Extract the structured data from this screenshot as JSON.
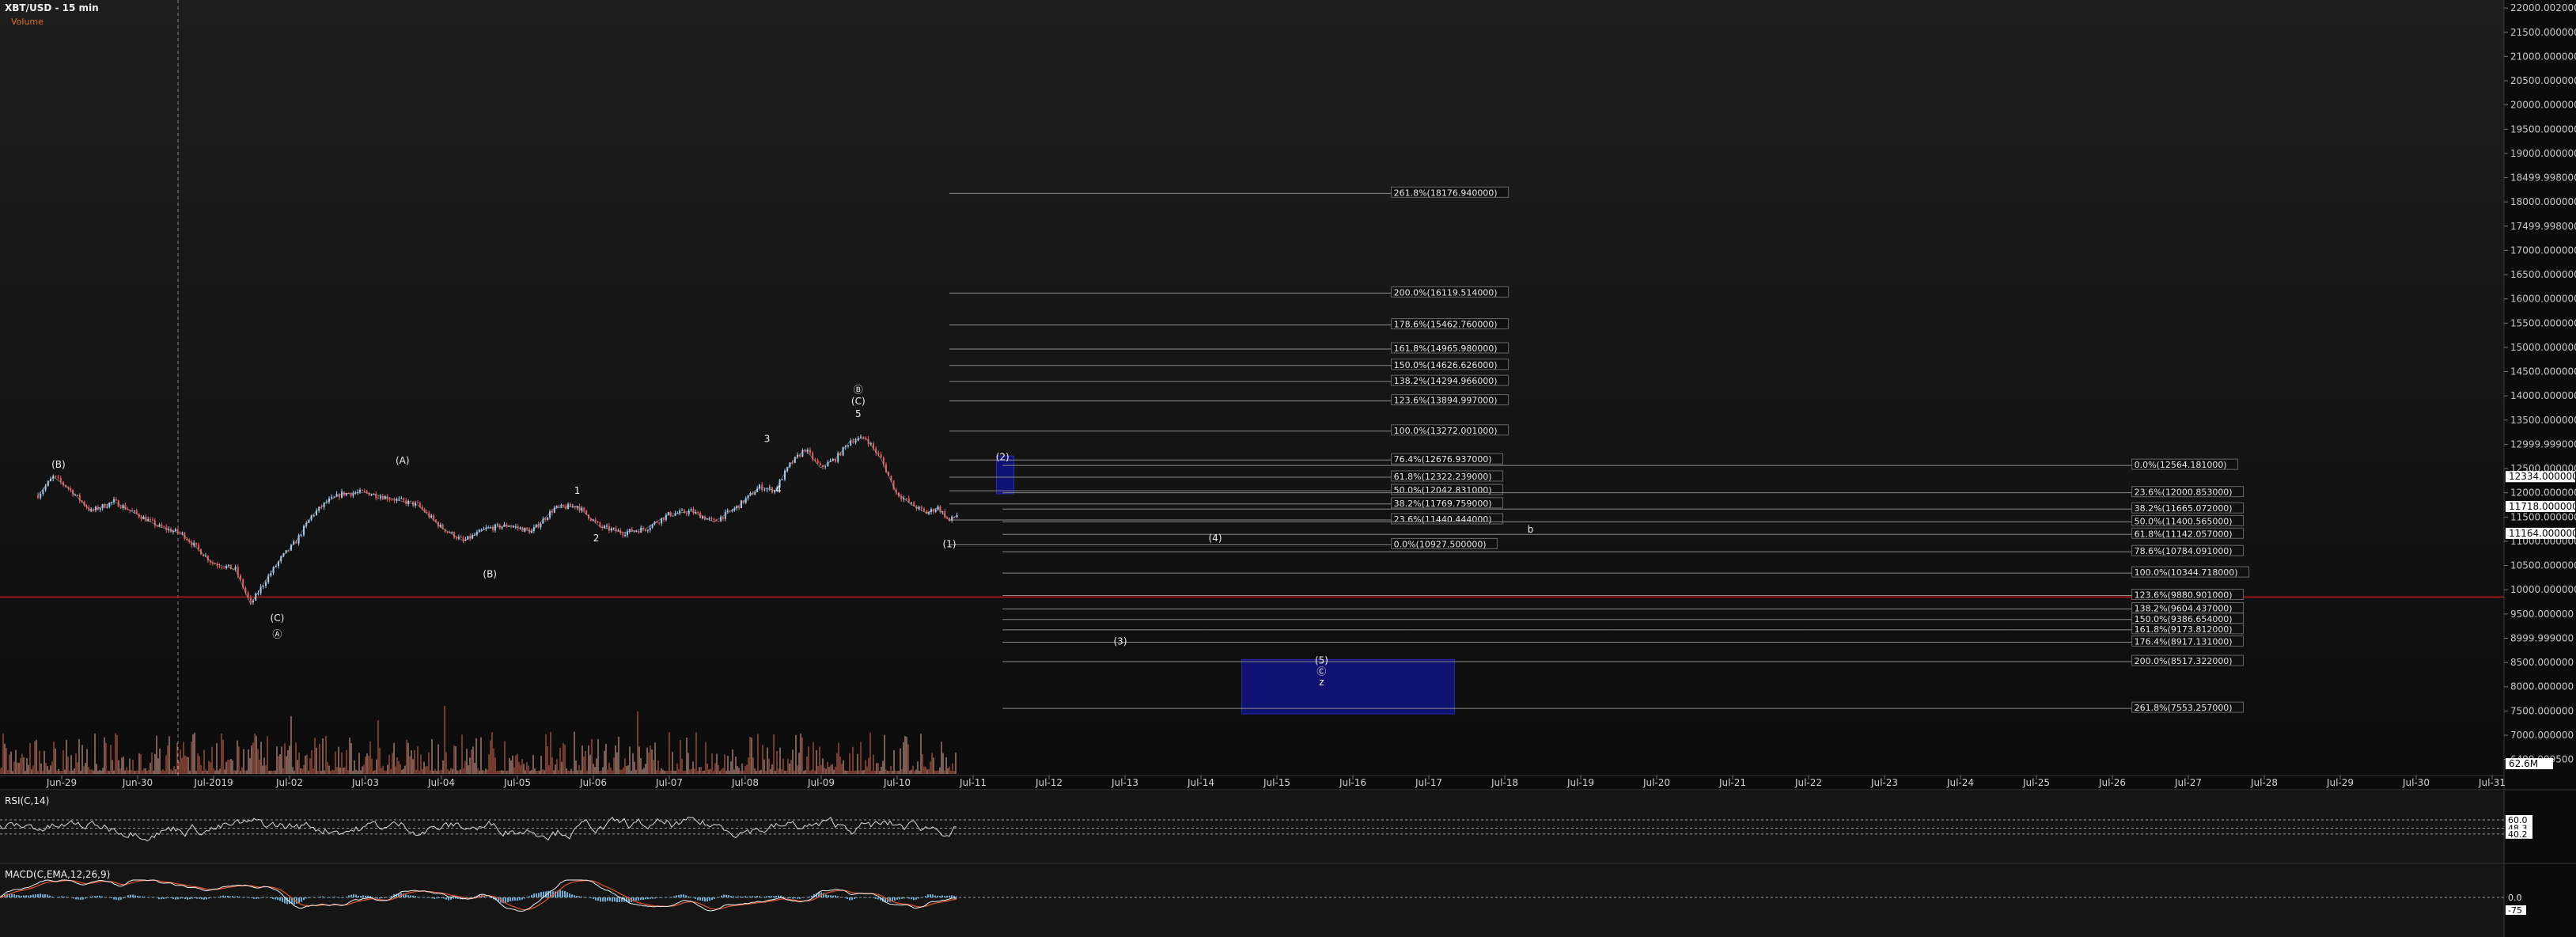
{
  "header": {
    "title": "XBT/USD - 15 min",
    "volume_label": "Volume"
  },
  "colors": {
    "background": "#0d0d0d",
    "grid": "#2a2a2a",
    "price_line": "#d0d0d0",
    "candle_up": "#9ecbf0",
    "candle_down": "#e05d5d",
    "fib_line": "#8a8a8a",
    "target_box": "#10127a",
    "support_line": "#c01818",
    "rsi_line": "#d8d8d8",
    "macd_line": "#f0f0f0",
    "signal_line": "#e4552b",
    "histogram": "#6aaed6"
  },
  "chart_data": [
    {
      "type": "line",
      "title": "XBT/USD - 15 min",
      "ylim": [
        6200,
        22100
      ],
      "y_ticks": [
        "22000.002000",
        "21500.000000",
        "21000.000000",
        "20500.000000",
        "20000.000000",
        "19500.000000",
        "19000.000000",
        "18499.998000",
        "18000.000000",
        "17499.998000",
        "17000.000000",
        "16500.000000",
        "16000.000000",
        "15500.000000",
        "15000.000000",
        "14500.000000",
        "14000.000000",
        "13500.000000",
        "12999.999000",
        "12500.000000",
        "12000.000000",
        "11500.000000",
        "11000.000000",
        "10500.000000",
        "10000.000000",
        "9500.000000",
        "8999.999000",
        "8500.000000",
        "8000.000000",
        "7500.000000",
        "7000.000000",
        "6499.999500"
      ],
      "x_ticks": [
        "Jun-29",
        "Jun-30",
        "Jul-2019",
        "Jul-02",
        "Jul-03",
        "Jul-04",
        "Jul-05",
        "Jul-06",
        "Jul-07",
        "Jul-08",
        "Jul-09",
        "Jul-10",
        "Jul-11",
        "Jul-12",
        "Jul-13",
        "Jul-14",
        "Jul-15",
        "Jul-16",
        "Jul-17",
        "Jul-18",
        "Jul-19",
        "Jul-20",
        "Jul-21",
        "Jul-22",
        "Jul-23",
        "Jul-24",
        "Jul-25",
        "Jul-26",
        "Jul-27",
        "Jul-28",
        "Jul-29",
        "Jul-30",
        "Jul-31"
      ],
      "price_path": {
        "x": [
          0,
          0.2,
          0.4,
          0.7,
          1,
          1.3,
          1.6,
          1.9,
          2.3,
          2.6,
          2.8,
          3,
          3.2,
          3.4,
          3.6,
          3.8,
          4,
          4.3,
          4.6,
          5,
          5.3,
          5.6,
          5.9,
          6.2,
          6.5,
          6.8,
          7.1,
          7.4,
          7.7,
          8,
          8.3,
          8.6,
          8.9,
          9.2,
          9.5,
          9.7,
          9.9,
          10.1,
          10.3,
          10.5,
          10.7,
          10.9,
          11.1,
          11.3,
          11.5,
          11.7,
          11.85,
          12,
          12.1
        ],
        "y": [
          11950,
          12330,
          12100,
          11620,
          11820,
          11560,
          11300,
          11150,
          10550,
          10420,
          9700,
          10200,
          10650,
          11000,
          11520,
          11810,
          11980,
          12010,
          11900,
          11750,
          11300,
          11000,
          11260,
          11330,
          11200,
          11680,
          11730,
          11300,
          11180,
          11260,
          11550,
          11620,
          11400,
          11700,
          12120,
          12050,
          12580,
          12900,
          12520,
          12700,
          13080,
          13130,
          12700,
          12000,
          11760,
          11580,
          11700,
          11420,
          11540
        ]
      },
      "current_price_markers": [
        "12334.000000",
        "11718.000000",
        "11164.000000"
      ],
      "support_level": 9850,
      "wave_labels": [
        {
          "text": "(B)",
          "x": 0.27,
          "y": 12520
        },
        {
          "text": "(A)",
          "x": 4.8,
          "y": 12600
        },
        {
          "text": "(B)",
          "x": 5.95,
          "y": 10260
        },
        {
          "text": "(C)",
          "x": 3.15,
          "y": 9350
        },
        {
          "text": "Ⓐ",
          "x": 3.15,
          "y": 9020
        },
        {
          "text": "1",
          "x": 7.1,
          "y": 11980
        },
        {
          "text": "2",
          "x": 7.35,
          "y": 11000
        },
        {
          "text": "3",
          "x": 9.6,
          "y": 13050
        },
        {
          "text": "4",
          "x": 9.75,
          "y": 12000
        },
        {
          "text": "Ⓑ",
          "x": 10.8,
          "y": 14060
        },
        {
          "text": "(C)",
          "x": 10.8,
          "y": 13820
        },
        {
          "text": "5",
          "x": 10.8,
          "y": 13560
        },
        {
          "text": "(1)",
          "x": 12.0,
          "y": 10880
        },
        {
          "text": "(2)",
          "x": 12.7,
          "y": 12670
        },
        {
          "text": "(3)",
          "x": 14.25,
          "y": 8870
        },
        {
          "text": "(4)",
          "x": 15.5,
          "y": 11000
        },
        {
          "text": "(5)",
          "x": 16.9,
          "y": 8480
        },
        {
          "text": "Ⓒ",
          "x": 16.9,
          "y": 8250
        },
        {
          "text": "z",
          "x": 16.9,
          "y": 8030
        },
        {
          "text": "b",
          "x": 19.65,
          "y": 11180
        }
      ],
      "fib_sets": [
        {
          "x_start": 12.0,
          "x_end": 19.1,
          "label_x": 17.85,
          "levels": [
            {
              "label": "261.8%(18176.940000)",
              "y": 18176.94
            },
            {
              "label": "200.0%(16119.514000)",
              "y": 16119.514
            },
            {
              "label": "178.6%(15462.760000)",
              "y": 15462.76
            },
            {
              "label": "161.8%(14965.980000)",
              "y": 14965.98
            },
            {
              "label": "150.0%(14626.626000)",
              "y": 14626.626
            },
            {
              "label": "138.2%(14294.966000)",
              "y": 14294.966
            },
            {
              "label": "123.6%(13894.997000)",
              "y": 13894.997
            },
            {
              "label": "100.0%(13272.001000)",
              "y": 13272.001
            },
            {
              "label": "76.4%(12676.937000)",
              "y": 12676.937
            },
            {
              "label": "61.8%(12322.239000)",
              "y": 12322.239
            },
            {
              "label": "50.0%(12042.831000)",
              "y": 12042.831
            },
            {
              "label": "38.2%(11769.759000)",
              "y": 11769.759
            },
            {
              "label": "23.6%(11440.444000)",
              "y": 11440.444
            },
            {
              "label": "0.0%(10927.500000)",
              "y": 10927.5
            }
          ]
        },
        {
          "x_start": 12.7,
          "x_end": 28.8,
          "label_x": 27.6,
          "levels": [
            {
              "label": "0.0%(12564.181000)",
              "y": 12564.181
            },
            {
              "label": "23.6%(12000.853000)",
              "y": 12000.853
            },
            {
              "label": "38.2%(11665.072000)",
              "y": 11665.072
            },
            {
              "label": "50.0%(11400.565000)",
              "y": 11400.565
            },
            {
              "label": "61.8%(11142.057000)",
              "y": 11142.057
            },
            {
              "label": "78.6%(10784.091000)",
              "y": 10784.091
            },
            {
              "label": "100.0%(10344.718000)",
              "y": 10344.718
            },
            {
              "label": "123.6%(9880.901000)",
              "y": 9880.901
            },
            {
              "label": "138.2%(9604.437000)",
              "y": 9604.437
            },
            {
              "label": "150.0%(9386.654000)",
              "y": 9386.654
            },
            {
              "label": "161.8%(9173.812000)",
              "y": 9173.812
            },
            {
              "label": "176.4%(8917.131000)",
              "y": 8917.131
            },
            {
              "label": "200.0%(8517.322000)",
              "y": 8517.322
            },
            {
              "label": "261.8%(7553.257000)",
              "y": 7553.257
            }
          ]
        }
      ],
      "target_boxes": [
        {
          "x0": 12.62,
          "x1": 12.85,
          "y0": 11980,
          "y1": 12760
        },
        {
          "x0": 15.85,
          "x1": 18.65,
          "y0": 7440,
          "y1": 8560
        }
      ]
    },
    {
      "type": "bar",
      "title": "Volume",
      "value_label": "62.6M",
      "x_range": [
        0,
        12.1
      ]
    },
    {
      "type": "line",
      "title": "RSI(C,14)",
      "levels": [
        "60.0",
        "48.3",
        "40.2"
      ],
      "x_range": [
        0,
        12.1
      ]
    },
    {
      "type": "line",
      "title": "MACD(C,EMA,12,26,9)",
      "levels": [
        "0.0",
        "-75"
      ],
      "x_range": [
        0,
        12.1
      ]
    }
  ]
}
